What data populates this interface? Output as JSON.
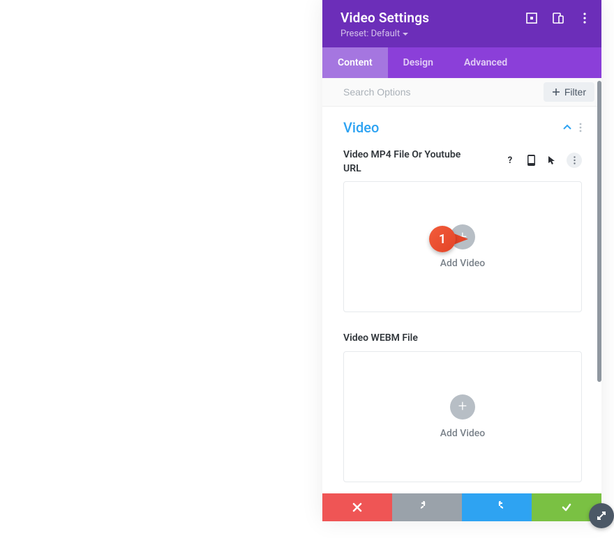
{
  "header": {
    "title": "Video Settings",
    "preset_label": "Preset: Default"
  },
  "tabs": [
    {
      "label": "Content",
      "active": true
    },
    {
      "label": "Design",
      "active": false
    },
    {
      "label": "Advanced",
      "active": false
    }
  ],
  "search": {
    "placeholder": "Search Options",
    "filter_label": "Filter"
  },
  "section": {
    "title": "Video",
    "fields": [
      {
        "label": "Video MP4 File Or Youtube URL",
        "add_label": "Add Video",
        "show_icons": true,
        "marker_number": "1"
      },
      {
        "label": "Video WEBM File",
        "add_label": "Add Video",
        "show_icons": false
      }
    ]
  },
  "colors": {
    "header_bg": "#6c2eb9",
    "tabs_bg": "#8b3fd9",
    "tab_active_bg": "#a576e0",
    "accent_blue": "#2ea3f2",
    "action_red": "#ef5555",
    "action_gray": "#9aa2aa",
    "action_green": "#7ac143",
    "marker_color": "#e34427"
  }
}
